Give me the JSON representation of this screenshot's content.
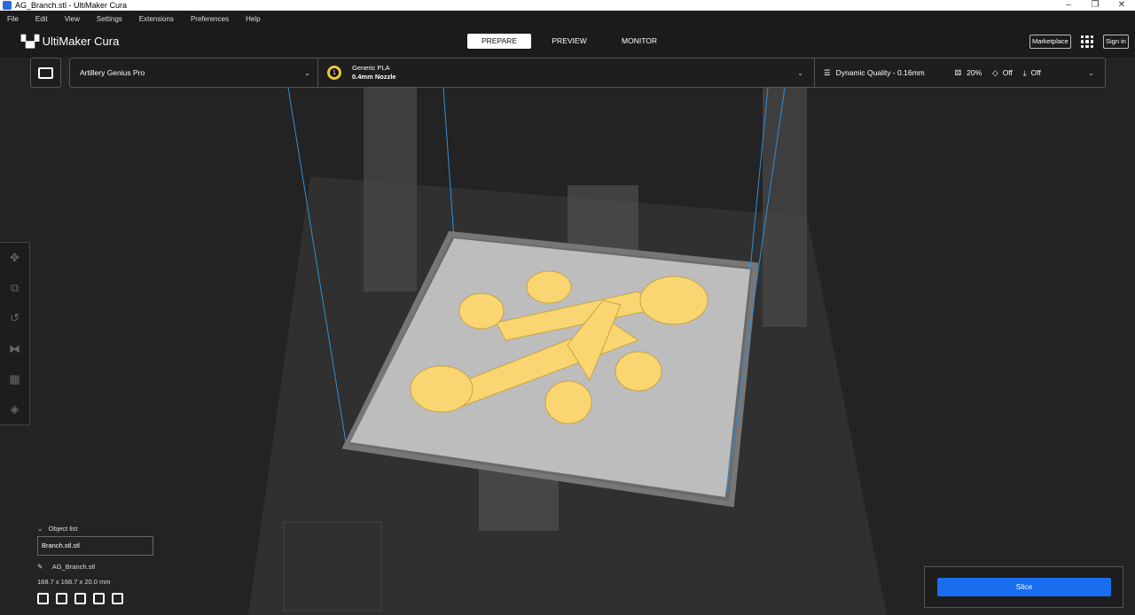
{
  "window": {
    "title": "AG_Branch.stl - UltiMaker Cura"
  },
  "menu": [
    "File",
    "Edit",
    "View",
    "Settings",
    "Extensions",
    "Preferences",
    "Help"
  ],
  "header": {
    "logo": "UltiMaker Cura",
    "tabs": [
      "PREPARE",
      "PREVIEW",
      "MONITOR"
    ],
    "marketplace": "Marketplace",
    "sign_in": "Sign in"
  },
  "stage": {
    "printer": "Artillery Genius Pro",
    "material": "Generic PLA",
    "nozzle": "0.4mm Nozzle",
    "extruder": "1",
    "profile": "Dynamic Quality - 0.16mm",
    "infill": "20%",
    "support": "Off",
    "adhesion": "Off"
  },
  "objects": {
    "header": "Object list",
    "selected": "Branch.stl.stl",
    "name": "AG_Branch.stl",
    "dimensions": "168.7 x 168.7 x 20.0 mm"
  },
  "slice": {
    "label": "Slice"
  },
  "colors": {
    "accent": "#196ef0",
    "model": "#f9d672"
  }
}
